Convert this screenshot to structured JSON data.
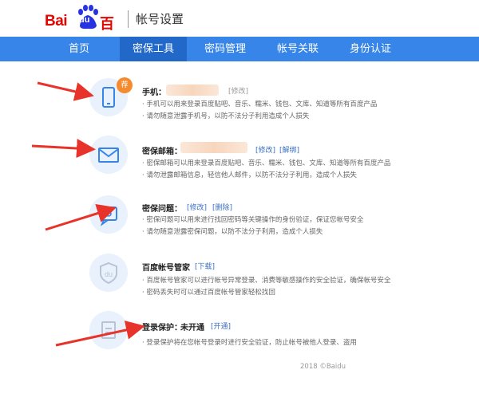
{
  "header": {
    "logo_latin": "Bai",
    "logo_du": "du",
    "logo_cn": "百度",
    "title": "帐号设置"
  },
  "nav": {
    "items": [
      {
        "label": "首页",
        "active": false
      },
      {
        "label": "密保工具",
        "active": true
      },
      {
        "label": "密码管理",
        "active": false
      },
      {
        "label": "帐号关联",
        "active": false
      },
      {
        "label": "身份认证",
        "active": false
      }
    ]
  },
  "security": {
    "phone": {
      "badge": "荐",
      "title": "手机：",
      "link_modify": "[修改]",
      "desc": [
        "· 手机可以用来登录百度贴吧、音乐、糯米、钱包、文库、知道等所有百度产品",
        "· 请勿随意泄露手机号，以防不法分子利用造成个人损失"
      ]
    },
    "email": {
      "title": "密保邮箱：",
      "link_modify": "[修改]",
      "link_unbind": "[解绑]",
      "desc": [
        "· 密保邮箱可以用来登录百度贴吧、音乐、糯米、钱包、文库、知道等所有百度产品",
        "· 请勿泄露邮箱信息，轻信他人邮件，以防不法分子利用，造成个人损失"
      ]
    },
    "question": {
      "title": "密保问题：",
      "link_modify": "[修改]",
      "link_delete": "[删除]",
      "desc": [
        "· 密保问题可以用来进行找回密码等关键操作的身份验证，保证您帐号安全",
        "· 请勿随意泄露密保问题，以防不法分子利用，造成个人损失"
      ]
    },
    "manager": {
      "title": "百度帐号管家",
      "link_download": "[下载]",
      "desc": [
        "· 百度帐号管家可以进行帐号异常登录、消费等敏感操作的安全验证，确保帐号安全",
        "· 密码丢失时可以通过百度帐号管家轻松找回"
      ]
    },
    "login_protect": {
      "title": "登录保护：",
      "status": "未开通",
      "link_open": "[开通]",
      "desc": [
        "· 登录保护将在您帐号登录时进行安全验证，防止帐号被他人登录、盗用"
      ]
    }
  },
  "footer": {
    "copyright": "2018 ©Baidu"
  },
  "colors": {
    "nav_bg": "#3785e8",
    "nav_active": "#2268c8",
    "brand_red": "#e10601",
    "arrow": "#e8332a",
    "link": "#3a6fc2"
  },
  "icons": [
    "phone-icon",
    "mail-icon",
    "lock-question-icon",
    "du-shield-icon",
    "login-protect-icon"
  ]
}
